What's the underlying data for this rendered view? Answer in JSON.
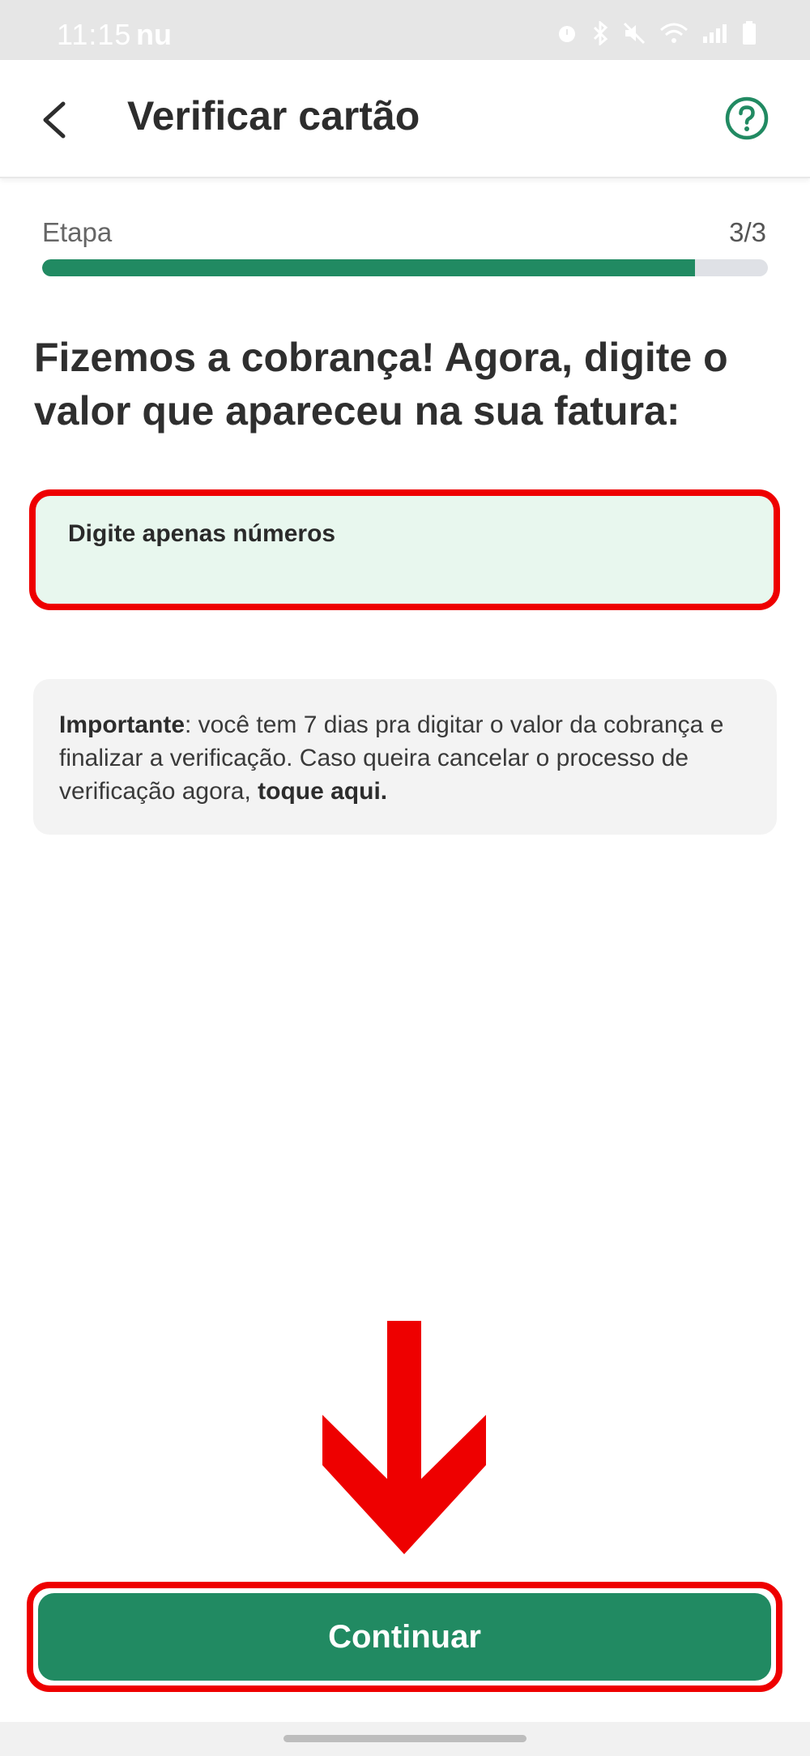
{
  "status_bar": {
    "time": "11:15",
    "brand": "nu",
    "icons": [
      "alarm-icon",
      "bluetooth-icon",
      "mute-icon",
      "wifi-icon",
      "signal-icon",
      "battery-icon"
    ]
  },
  "app_bar": {
    "title": "Verificar cartão",
    "back_icon": "chevron-left-icon",
    "help_icon": "help-circle-icon"
  },
  "progress": {
    "label": "Etapa",
    "count": "3/3",
    "fill_fraction": 0.9
  },
  "heading": "Fizemos a cobrança! Agora, digite o valor que apareceu na sua fatura:",
  "amount_input": {
    "placeholder": "Digite apenas números",
    "value": ""
  },
  "info": {
    "bold_label": "Importante",
    "text": ": você tem 7 dias pra digitar o valor da cobrança e finalizar a verificação. Caso queira cancelar o processo de verificação agora, ",
    "link": "toque aqui."
  },
  "continue_button": {
    "label": "Continuar"
  },
  "colors": {
    "primary": "#218a62",
    "annotation": "#ee0000",
    "input_bg": "#e8f7ee"
  }
}
